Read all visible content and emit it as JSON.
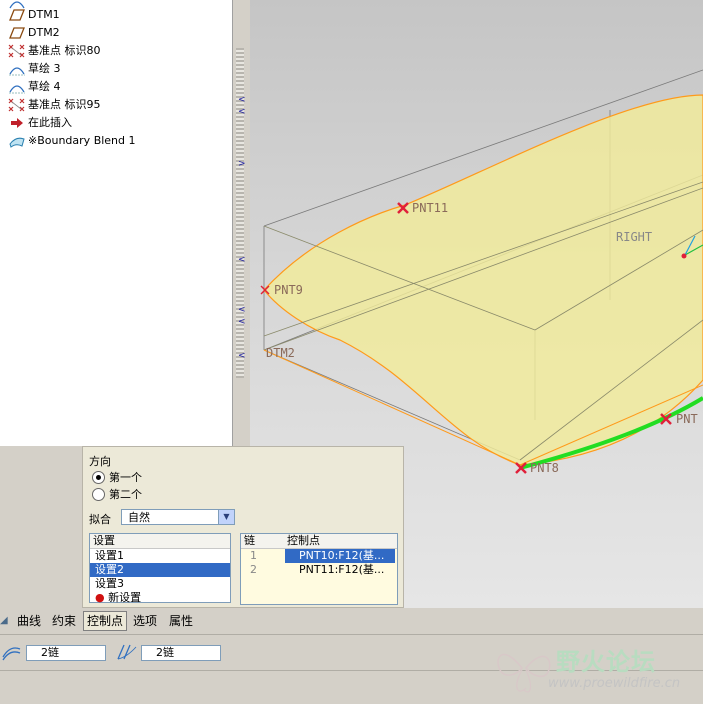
{
  "model_tree": {
    "items": [
      {
        "label": "DTM1",
        "icon": "datum-plane-icon"
      },
      {
        "label": "DTM2",
        "icon": "datum-plane-icon"
      },
      {
        "label": "基准点 标识80",
        "icon": "datum-point-icon"
      },
      {
        "label": "草绘 3",
        "icon": "sketch-icon"
      },
      {
        "label": "草绘 4",
        "icon": "sketch-icon"
      },
      {
        "label": "基准点 标识95",
        "icon": "datum-point-icon"
      },
      {
        "label": "在此插入",
        "icon": "insert-here-arrow-icon"
      },
      {
        "label": "※Boundary Blend 1",
        "icon": "boundary-blend-icon"
      }
    ]
  },
  "viewport": {
    "labels": {
      "pnt11": "PNT11",
      "pnt9": "PNT9",
      "right": "RIGHT",
      "dtm2": "DTM2",
      "pnt_right": "PNT",
      "pnt_bottom": "PNT8"
    },
    "colors": {
      "surface": "#f2ec9a",
      "edge": "#ff9a1a",
      "curve": "#22dd22",
      "point": "#e0203a"
    }
  },
  "options_panel": {
    "direction_label": "方向",
    "first_option": "第一个",
    "second_option": "第二个",
    "selected_direction": "第一个",
    "fit_label": "拟合",
    "fit_value": "自然",
    "sets_header": "设置",
    "sets": [
      "设置1",
      "设置2",
      "设置3",
      "新设置"
    ],
    "selected_set": "设置2",
    "chain_header": "链",
    "control_points_header": "控制点",
    "rows": [
      {
        "chain": "1",
        "points": "PNT10:F12(基..."
      },
      {
        "chain": "2",
        "points": "PNT11:F12(基..."
      }
    ]
  },
  "tabs": [
    "曲线",
    "约束",
    "控制点",
    "选项",
    "属性"
  ],
  "active_tab": "控制点",
  "dashboard": {
    "first_direction_value": "2链",
    "second_direction_value": "2链"
  },
  "watermark": {
    "title": "野火论坛",
    "url": "www.proewildfire.cn"
  }
}
